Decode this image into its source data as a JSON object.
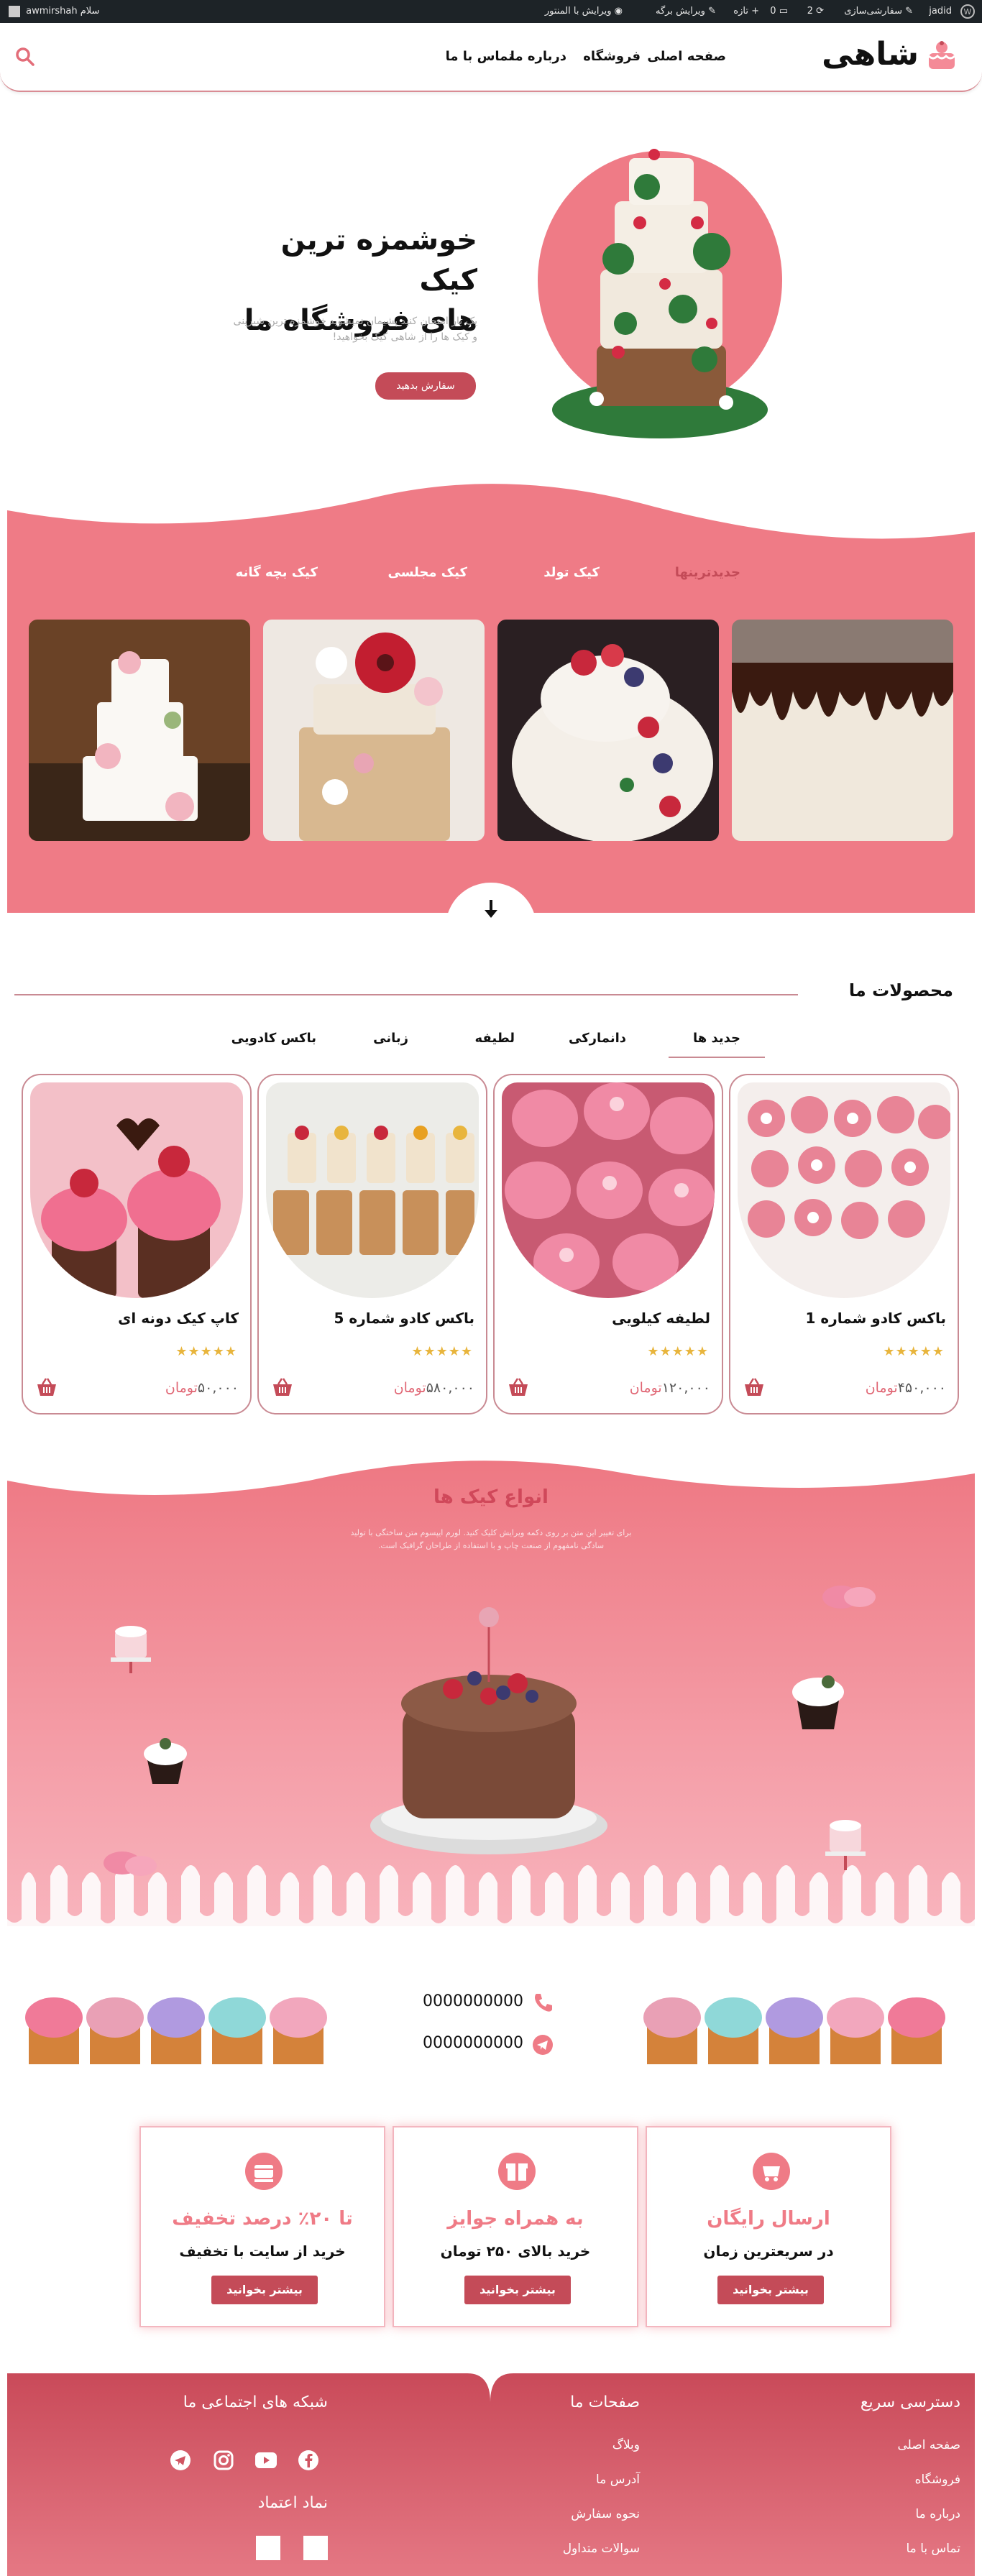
{
  "admin_bar": {
    "site_label": "jadid",
    "customize": "سفارشی‌سازی",
    "updates": "2",
    "comments": "0",
    "new": "تازه",
    "edit_page": "ویرایش برگه",
    "edit_elementor": "ویرایش با المنتور",
    "greeting": "سلام awmirshah"
  },
  "header": {
    "logo_text": "شاهی",
    "nav": [
      "صفحه اصلی",
      "فروشگاه",
      "درباره ما",
      "تماس با ما"
    ]
  },
  "hero": {
    "title_line1": "خوشمزه ترین کیک",
    "title_line2": "های فروشگاه ما",
    "description": "یک بار امتحان کنید پشیمان نمیشوید خوشمزه ترین شیرینی و کیک ها را از شاهی کیک بخواهید!",
    "button": "سفارش بدهید"
  },
  "categories": {
    "tabs": [
      "جدیدترینها",
      "کیک تولد",
      "کیک مجلسی",
      "کیک بچه گانه"
    ],
    "active_color": "#c44b58"
  },
  "products": {
    "heading": "محصولات ما",
    "tabs": [
      "جدید ها",
      "دانمارکی",
      "لطیفه",
      "زبانی",
      "باکس کادویی"
    ],
    "items": [
      {
        "name": "باکس کادو شماره 1",
        "price": "۴۵۰,۰۰۰",
        "currency": "تومان",
        "rating": 5
      },
      {
        "name": "لطیفه کیلویی",
        "price": "۱۲۰,۰۰۰",
        "currency": "تومان",
        "rating": 5
      },
      {
        "name": "باکس کادو شماره 5",
        "price": "۵۸۰,۰۰۰",
        "currency": "تومان",
        "rating": 5
      },
      {
        "name": "کاپ کیک دونه ای",
        "price": "۵۰,۰۰۰",
        "currency": "تومان",
        "rating": 5
      }
    ]
  },
  "types": {
    "title": "انواع کیک ها",
    "description": "برای تغییر این متن بر روی دکمه ویرایش کلیک کنید. لورم ایپسوم متن ساختگی با تولید سادگی نامفهوم از صنعت چاپ و با استفاده از طراحان گرافیک است."
  },
  "contact": {
    "phone": "0000000000",
    "telegram": "0000000000"
  },
  "features": [
    {
      "title": "ارسال رایگان",
      "subtitle": "در سریعترین زمان",
      "button": "بیشتر بخوانید"
    },
    {
      "title": "به همراه جوایز",
      "subtitle": "خرید بالای ۲۵۰ تومان",
      "button": "بیشتر بخوانید"
    },
    {
      "title": "تا ۲۰٪ درصد تخفیف",
      "subtitle": "خرید از سایت با تخفیف",
      "button": "بیشتر بخوانید"
    }
  ],
  "footer": {
    "quick_access": {
      "heading": "دسترسی سریع",
      "links": [
        "صفحه اصلی",
        "فروشگاه",
        "درباره ما",
        "تماس با ما"
      ]
    },
    "pages": {
      "heading": "صفحات ما",
      "links": [
        "وبلاگ",
        "آدرس ما",
        "نحوه سفارش",
        "سوالات متداول"
      ]
    },
    "social": {
      "heading": "شبکه های اجتماعی ما",
      "trust_heading": "نماد اعتماد"
    }
  },
  "colors": {
    "brand_pink": "#ef7b86",
    "brand_red": "#c44b58",
    "footer_red": "#d05563",
    "star": "#e8b53d"
  }
}
